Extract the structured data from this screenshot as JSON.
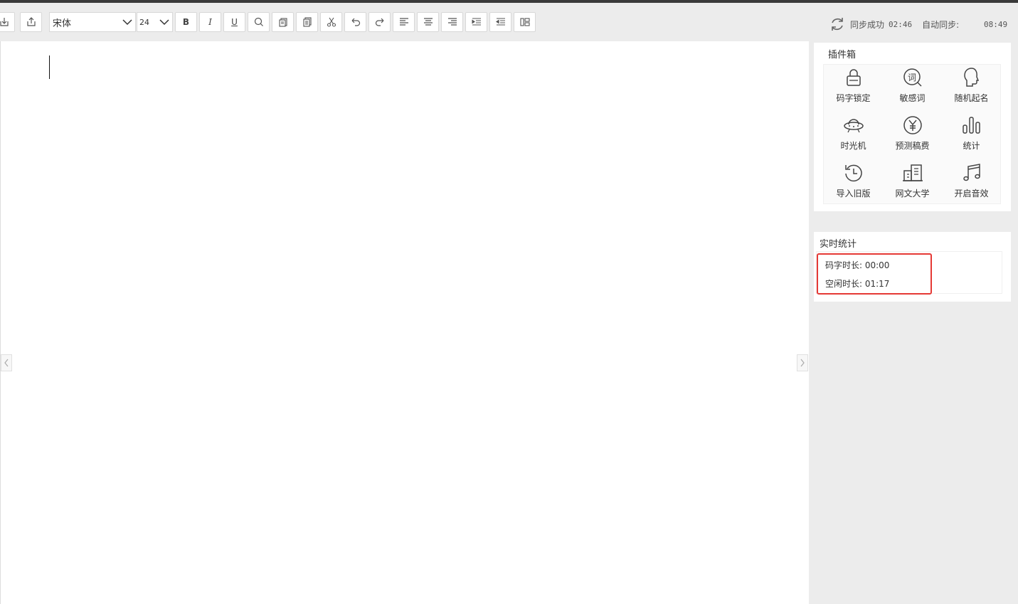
{
  "toolbar": {
    "font_family": "宋体",
    "font_size": "24",
    "bold": "B",
    "italic": "I",
    "underline": "U",
    "sync_status": "同步成功",
    "sync_time": "02:46",
    "auto_sync_label": "自动同步:",
    "auto_sync_time": "08:49"
  },
  "plugins": {
    "title": "插件箱",
    "items": [
      {
        "label": "码字锁定",
        "icon": "lock-icon"
      },
      {
        "label": "敏感词",
        "icon": "sensitive-word-icon"
      },
      {
        "label": "随机起名",
        "icon": "head-icon"
      },
      {
        "label": "时光机",
        "icon": "ufo-icon"
      },
      {
        "label": "预测稿费",
        "icon": "yen-icon"
      },
      {
        "label": "统计",
        "icon": "bar-chart-icon"
      },
      {
        "label": "导入旧版",
        "icon": "history-icon"
      },
      {
        "label": "网文大学",
        "icon": "building-icon"
      },
      {
        "label": "开启音效",
        "icon": "music-icon"
      }
    ]
  },
  "stats": {
    "title": "实时统计",
    "typing_time": "码字时长: 00:00",
    "idle_time": "空闲时长: 01:17"
  }
}
